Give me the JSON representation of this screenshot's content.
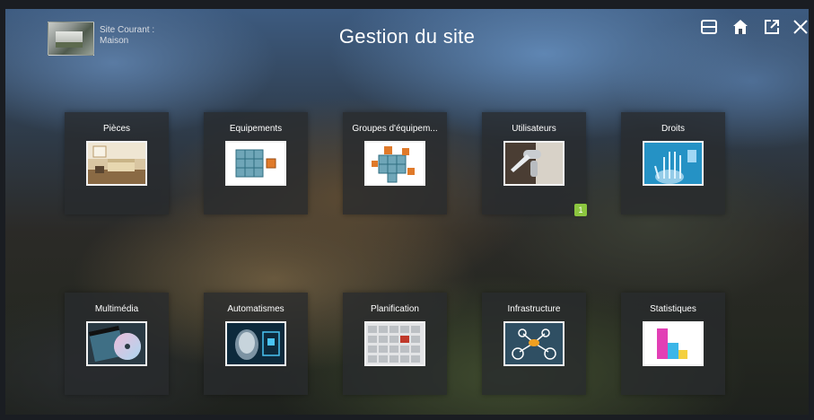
{
  "header": {
    "site_label_line1": "Site Courant :",
    "site_label_line2": "Maison",
    "title": "Gestion du site",
    "icons": [
      "screen-icon",
      "home-icon",
      "external-link-icon",
      "close-icon"
    ]
  },
  "tiles": [
    {
      "label": "Pièces",
      "icon": "room-image"
    },
    {
      "label": "Equipements",
      "icon": "cubes-image"
    },
    {
      "label": "Groupes d'équipem...",
      "icon": "cubes-group-image"
    },
    {
      "label": "Utilisateurs",
      "icon": "door-handle-image",
      "badge": "1"
    },
    {
      "label": "Droits",
      "icon": "fingerprint-hand-image"
    },
    {
      "label": "Multimédia",
      "icon": "film-disc-image"
    },
    {
      "label": "Automatismes",
      "icon": "robot-image"
    },
    {
      "label": "Planification",
      "icon": "calendar-image"
    },
    {
      "label": "Infrastructure",
      "icon": "network-image"
    },
    {
      "label": "Statistiques",
      "icon": "bar-chart-image"
    }
  ],
  "colors": {
    "badge": "#8cc63f",
    "tile_bg": "#282a2d"
  }
}
